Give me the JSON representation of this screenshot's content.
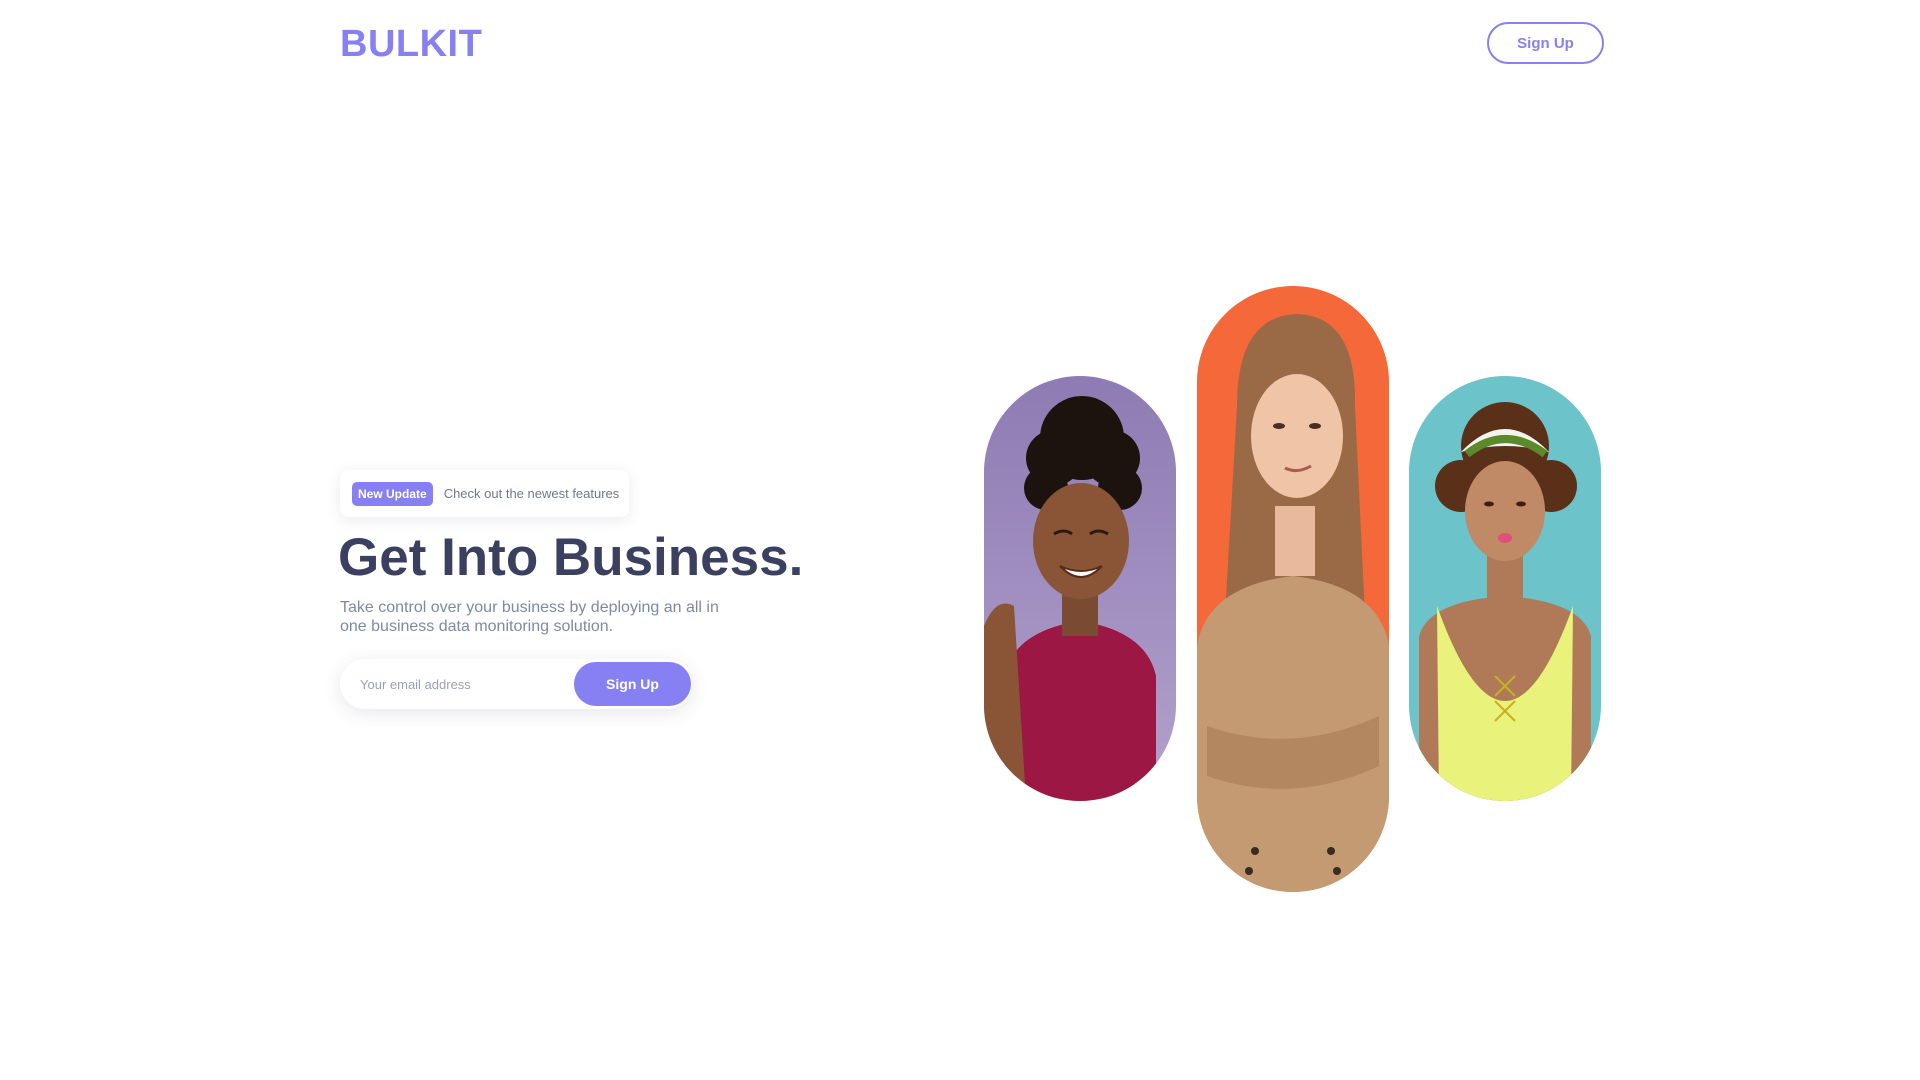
{
  "header": {
    "logo": "BULKIT",
    "signup_label": "Sign Up"
  },
  "hero": {
    "badge": "New Update",
    "badge_text": "Check out the newest features",
    "title": "Get Into Business.",
    "subtitle": "Take control over your business by deploying an all in one business data monitoring solution."
  },
  "form": {
    "email_placeholder": "Your email address",
    "email_value": "",
    "submit_label": "Sign Up"
  },
  "portraits": [
    {
      "name": "portrait-woman-purple",
      "background": "#a08fc0",
      "clothing": "#9d1745"
    },
    {
      "name": "portrait-woman-orange",
      "background": "#f4683a",
      "clothing": "#c49a72"
    },
    {
      "name": "portrait-woman-teal",
      "background": "#6cc3c9",
      "clothing": "#e9f27a"
    }
  ],
  "colors": {
    "accent": "#8780f2",
    "title": "#3c4060",
    "text_muted": "#7d8aa3"
  }
}
